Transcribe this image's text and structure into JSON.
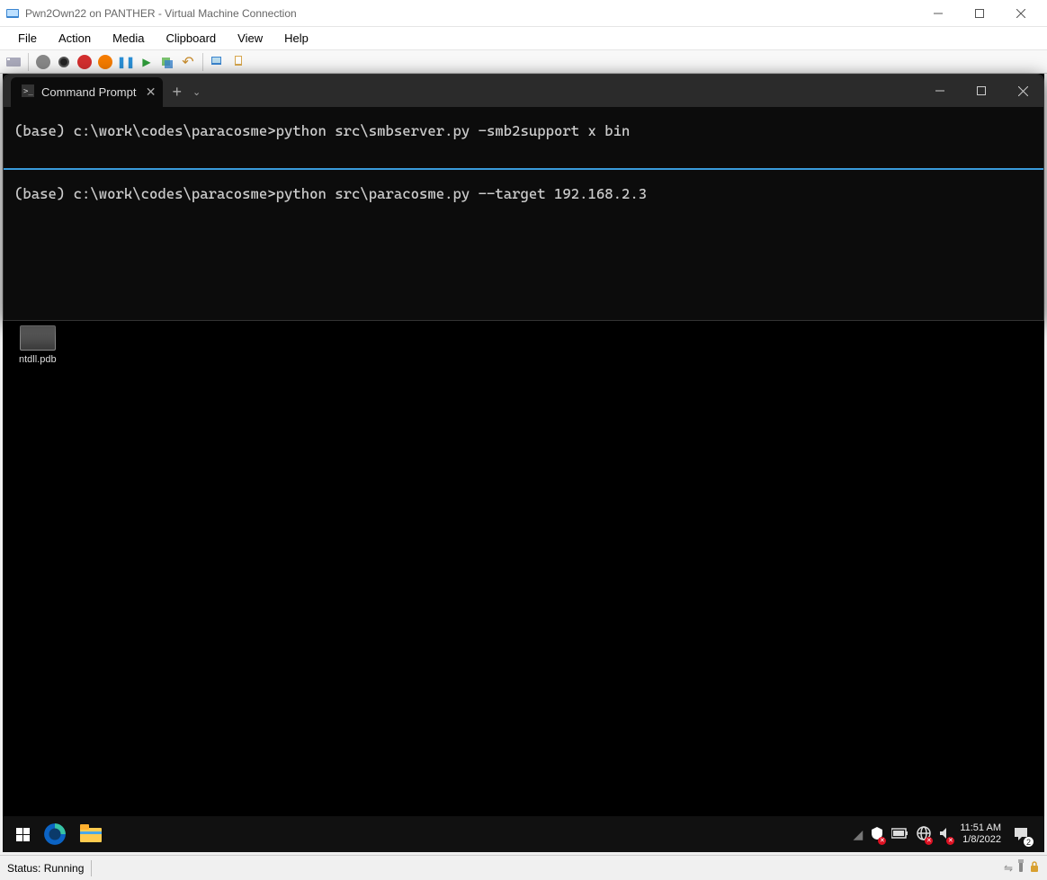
{
  "window": {
    "title": "Pwn2Own22 on PANTHER - Virtual Machine Connection"
  },
  "menu": {
    "items": [
      "File",
      "Action",
      "Media",
      "Clipboard",
      "View",
      "Help"
    ]
  },
  "terminal": {
    "tab_title": "Command Prompt",
    "pane1": "(base) c:\\work\\codes\\paracosme>python src\\smbserver.py -smb2support x bin",
    "pane2": "(base) c:\\work\\codes\\paracosme>python src\\paracosme.py --target 192.168.2.3"
  },
  "desktop": {
    "file1": "ntdll.pdb"
  },
  "vm_taskbar": {
    "time": "11:51 AM",
    "date": "1/8/2022",
    "notification_count": "2"
  },
  "status": {
    "text": "Status: Running"
  }
}
